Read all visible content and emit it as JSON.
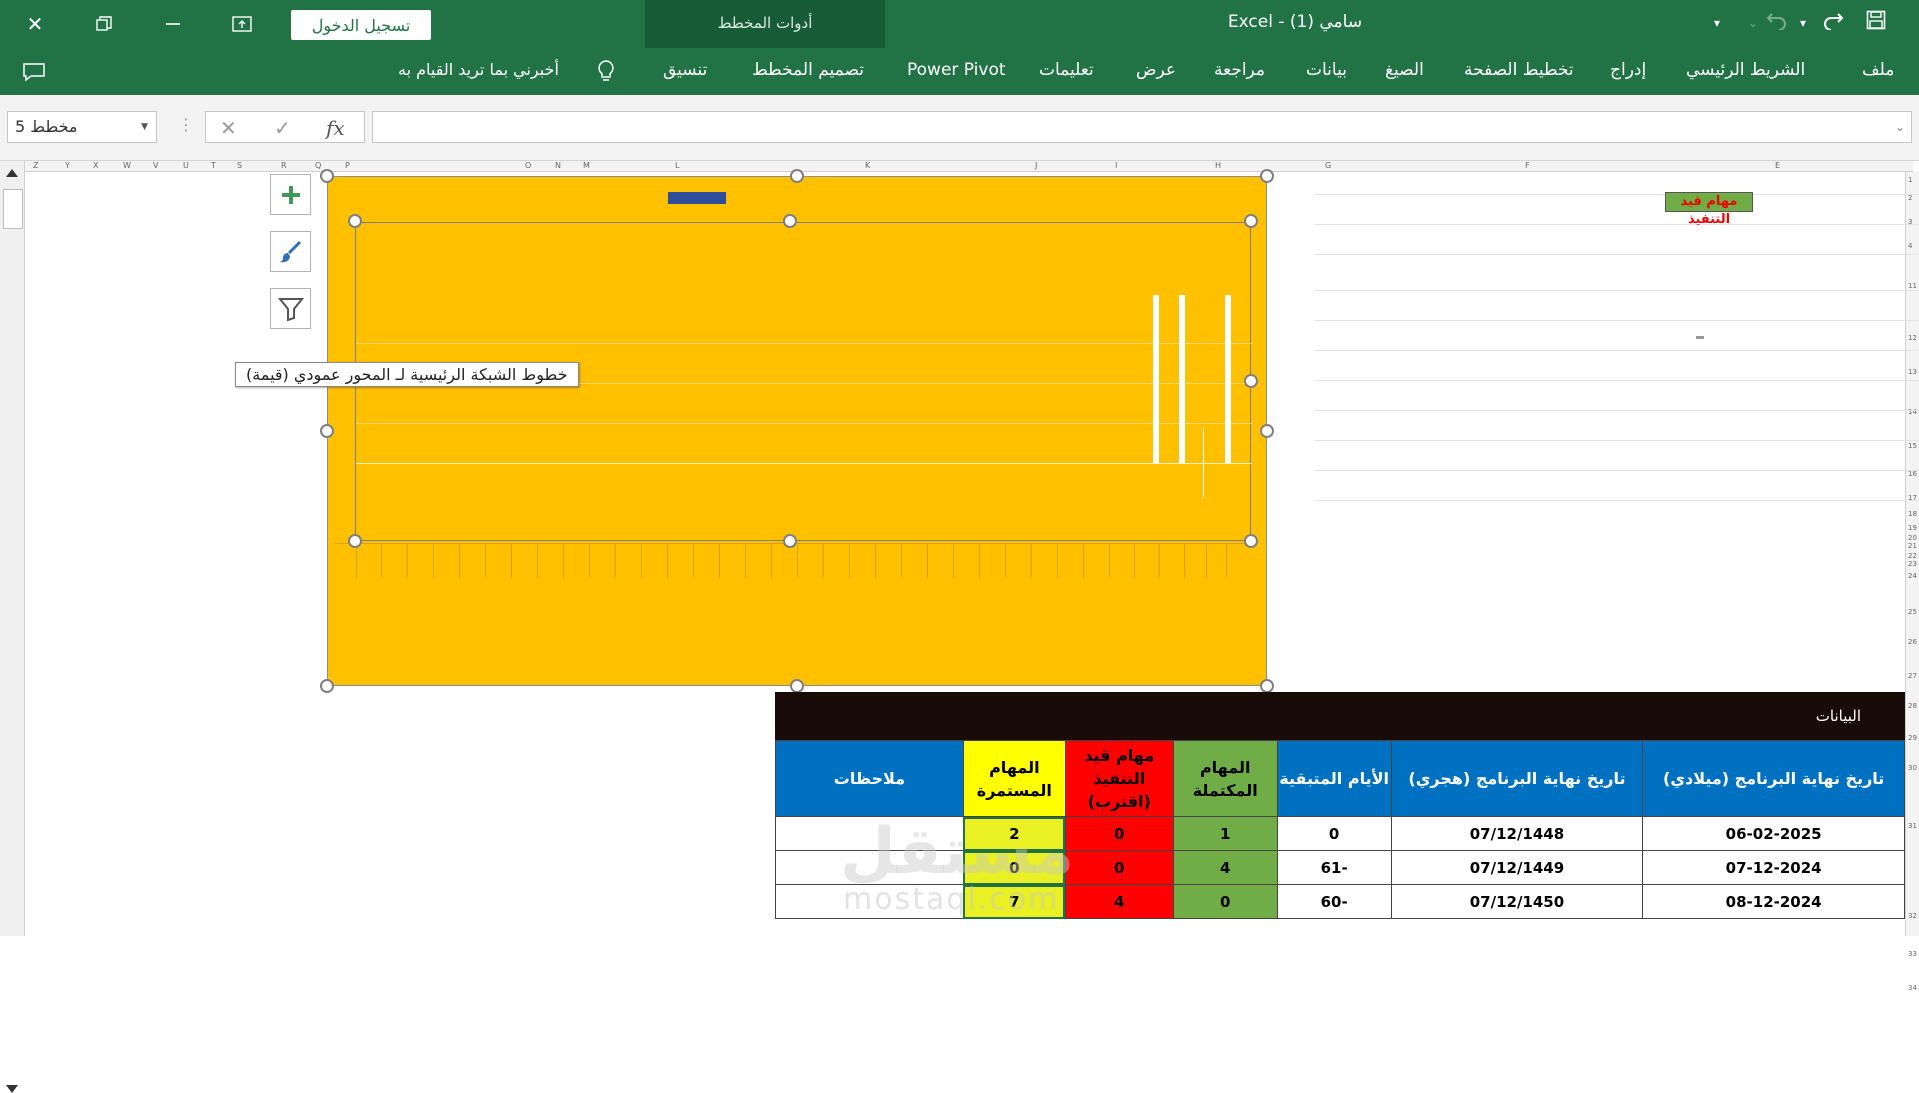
{
  "titlebar": {
    "document_title": "سامي (1)  -  Excel",
    "signin_label": "تسجيل الدخول",
    "context_group_label": "أدوات المخطط"
  },
  "ribbon": {
    "tabs": [
      "ملف",
      "الشريط الرئيسي",
      "إدراج",
      "تخطيط الصفحة",
      "الصيغ",
      "بيانات",
      "مراجعة",
      "عرض",
      "تعليمات",
      "Power Pivot"
    ],
    "context_tabs": [
      "تصميم المخطط",
      "تنسيق"
    ],
    "tell_me": "أخبرني بما تريد القيام به"
  },
  "formula_bar": {
    "name_box": "مخطط 5",
    "cancel_icon": "✕",
    "enter_icon": "✓",
    "fx_label": "fx",
    "formula": ""
  },
  "columns": [
    "Z",
    "Y",
    "X",
    "W",
    "V",
    "U",
    "T",
    "S",
    "R",
    "Q",
    "P",
    "O",
    "N",
    "M",
    "L",
    "K",
    "J",
    "I",
    "H",
    "G",
    "F",
    "E"
  ],
  "sheet": {
    "label": "مهام قيد التنفيذ"
  },
  "chart": {
    "tooltip": "خطوط الشبكة الرئيسية لـ المحور عمودي (قيمة)"
  },
  "table": {
    "header": "البيانات",
    "columns": [
      "تاريخ نهاية البرنامج (ميلادي)",
      "تاريخ نهاية البرنامج (هجري)",
      "الأيام المتبقية",
      "المهام المكتملة",
      "مهام قيد التنفيذ (اقترب)",
      "المهام المستمرة",
      "ملاحظات"
    ],
    "rows": [
      [
        "06-02-2025",
        "07/12/1448",
        "0",
        "1",
        "0",
        "2",
        ""
      ],
      [
        "07-12-2024",
        "07/12/1449",
        "-61",
        "4",
        "0",
        "0",
        ""
      ],
      [
        "08-12-2024",
        "07/12/1450",
        "-60",
        "0",
        "4",
        "7",
        ""
      ]
    ]
  },
  "colors": {
    "excel_green": "#217346",
    "chart_fill": "#ffc000",
    "header_blue": "#0070c0",
    "completed_green": "#70ad47",
    "pending_red": "#ff0000",
    "ongoing_yellow": "#ffff00"
  },
  "watermark": {
    "arabic": "مستقل",
    "latin": "mostaql.com"
  }
}
